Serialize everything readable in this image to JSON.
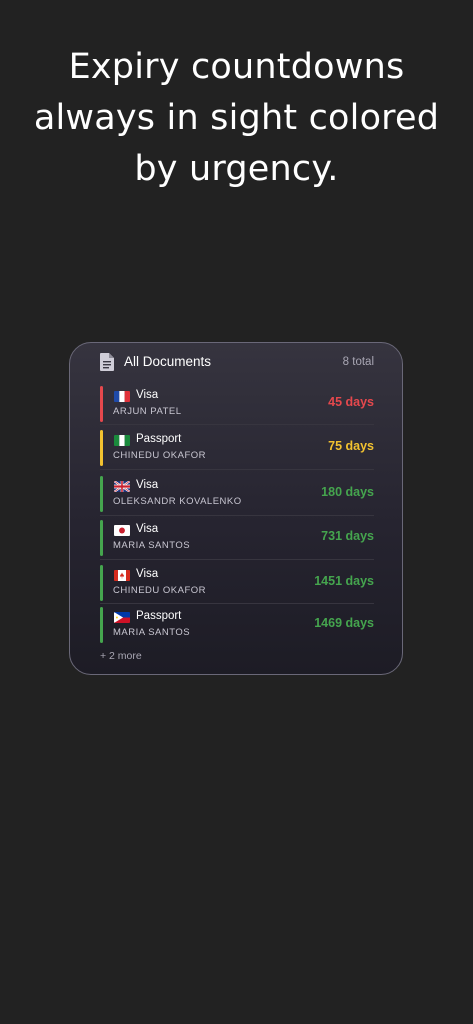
{
  "headline": {
    "line1": "Expiry countdowns",
    "line2": "always in sight colored",
    "line3": "by urgency."
  },
  "widget": {
    "icon": "document-icon",
    "title": "All Documents",
    "total": "8 total",
    "more": "+ 2 more",
    "colors": {
      "red": "#e5484d",
      "yellow": "#f2c230",
      "green": "#45a54e"
    },
    "items": [
      {
        "flag": "france-flag",
        "type": "Visa",
        "holder": "ARJUN PATEL",
        "days": "45 days",
        "urgency": "red"
      },
      {
        "flag": "nigeria-flag",
        "type": "Passport",
        "holder": "CHINEDU OKAFOR",
        "days": "75 days",
        "urgency": "yellow"
      },
      {
        "flag": "uk-flag",
        "type": "Visa",
        "holder": "OLEKSANDR KOVALENKO",
        "days": "180 days",
        "urgency": "green"
      },
      {
        "flag": "japan-flag",
        "type": "Visa",
        "holder": "MARIA SANTOS",
        "days": "731 days",
        "urgency": "green"
      },
      {
        "flag": "canada-flag",
        "type": "Visa",
        "holder": "CHINEDU OKAFOR",
        "days": "1451 days",
        "urgency": "green"
      },
      {
        "flag": "philippines-flag",
        "type": "Passport",
        "holder": "MARIA SANTOS",
        "days": "1469 days",
        "urgency": "green"
      }
    ]
  }
}
